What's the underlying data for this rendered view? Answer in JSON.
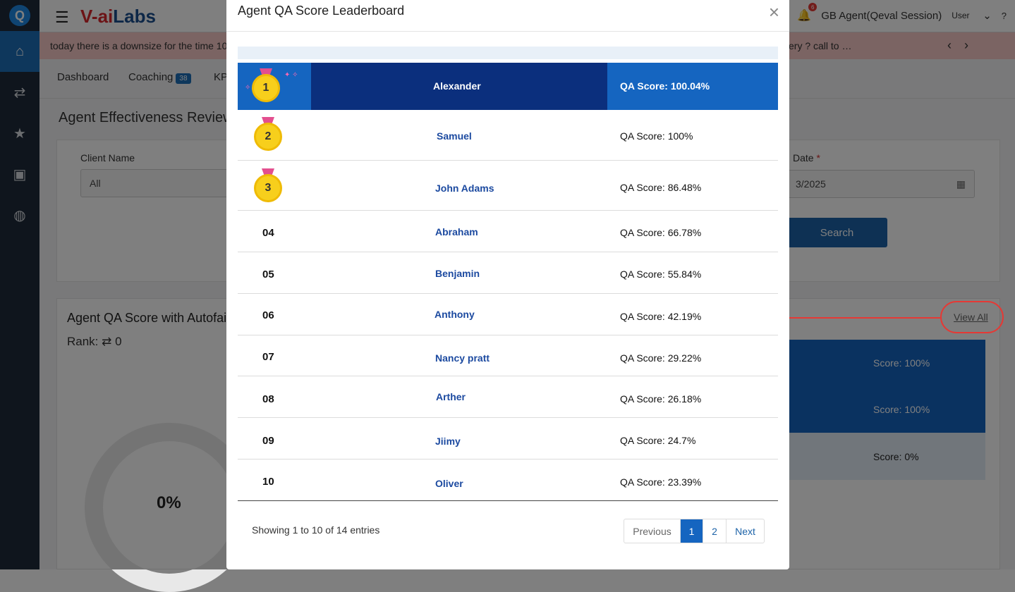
{
  "header": {
    "brand_left": "V-",
    "brand_mid": "ai",
    "brand_right": "Labs",
    "user": "GB Agent(Qeval Session)",
    "user_img_alt": "User",
    "notif_count": "6"
  },
  "ticker": {
    "text_left": "today there is a downsize for the time 10",
    "text_right": "ery ? call to …"
  },
  "tabs": [
    {
      "label": "Dashboard"
    },
    {
      "label": "Coaching",
      "count": "38"
    },
    {
      "label": "KP"
    }
  ],
  "page": {
    "title": "Agent Effectiveness Review"
  },
  "filters": {
    "client_label": "Client Name",
    "client_value": "All",
    "date_label": "Date",
    "date_value": "3/2025",
    "search_label": "Search"
  },
  "card2": {
    "title": "Agent QA Score with Autofai",
    "rank_label": "Rank:",
    "rank_value": "0",
    "view_all": "View All",
    "donut_value": "0%",
    "bg_scores": [
      "Score: 100%",
      "Score: 100%",
      "Score: 0%"
    ]
  },
  "modal": {
    "title": "Agent QA Score Leaderboard",
    "rows": [
      {
        "rank": "1",
        "name": "Alexander",
        "score": "QA Score: 100.04%"
      },
      {
        "rank": "2",
        "name": "Samuel",
        "score": "QA Score: 100%"
      },
      {
        "rank": "3",
        "name": "John Adams",
        "score": "QA Score: 86.48%"
      },
      {
        "rank": "04",
        "name": "Abraham",
        "score": "QA Score: 66.78%"
      },
      {
        "rank": "05",
        "name": "Benjamin",
        "score": "QA Score: 55.84%"
      },
      {
        "rank": "06",
        "name": "Anthony",
        "score": "QA Score: 42.19%"
      },
      {
        "rank": "07",
        "name": "Nancy pratt",
        "score": "QA Score: 29.22%"
      },
      {
        "rank": "08",
        "name": "Arther",
        "score": "QA Score: 26.18%"
      },
      {
        "rank": "09",
        "name": "Jiimy",
        "score": "QA Score: 24.7%"
      },
      {
        "rank": "10",
        "name": "Oliver",
        "score": "QA Score: 23.39%"
      }
    ],
    "showing": "Showing 1 to 10 of 14 entries",
    "pager": {
      "prev": "Previous",
      "p1": "1",
      "p2": "2",
      "next": "Next"
    }
  },
  "colors": {
    "primary": "#1565c0",
    "dark_navy": "#0b2f7d",
    "sidebar": "#1f2a3a",
    "annotation_red": "#e53935",
    "ticker_bg": "#f6c9c7"
  }
}
